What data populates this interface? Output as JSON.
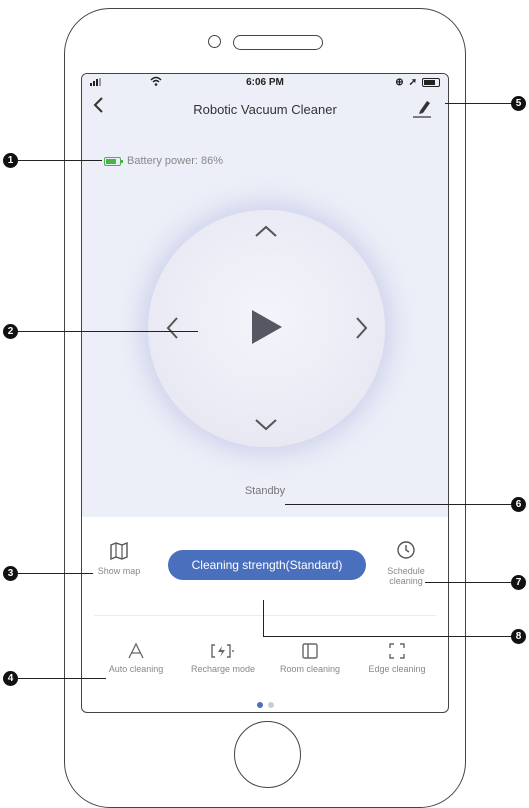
{
  "status_bar": {
    "time": "6:06 PM"
  },
  "header": {
    "title": "Robotic Vacuum Cleaner"
  },
  "battery": {
    "label": "Battery power: 86%",
    "level_percent": 86,
    "color": "#46b446"
  },
  "control": {
    "state": "Standby"
  },
  "tools": {
    "show_map": "Show map",
    "strength_button": "Cleaning strength(Standard)",
    "schedule": "Schedule cleaning"
  },
  "modes": [
    {
      "label": "Auto cleaning",
      "icon": "letter-a-icon"
    },
    {
      "label": "Recharge mode",
      "icon": "recharge-icon"
    },
    {
      "label": "Room cleaning",
      "icon": "room-icon"
    },
    {
      "label": "Edge cleaning",
      "icon": "edge-icon"
    }
  ],
  "pagination": {
    "pages": 2,
    "active": 1
  },
  "callouts": [
    "1",
    "2",
    "3",
    "4",
    "5",
    "6",
    "7",
    "8"
  ],
  "colors": {
    "accent": "#4a70bd",
    "panel_bg": "#eceef8"
  }
}
